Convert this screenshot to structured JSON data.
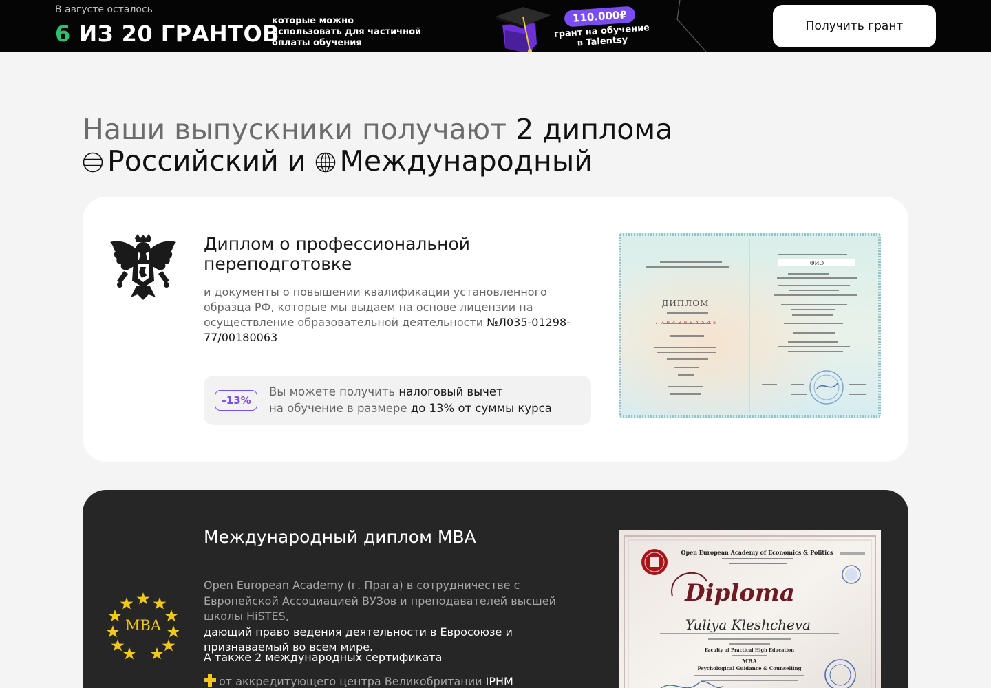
{
  "banner": {
    "remain_label": "В августе осталось",
    "count_num": "6",
    "count_text": " ИЗ 20 ГРАНТОВ",
    "desc": "которые можно использовать для частичной оплаты обучения",
    "promo_amount": "110.000₽",
    "promo_text": "грант на обучение в Talentsy",
    "cta": "Получить грант"
  },
  "headline": {
    "part1": "Наши выпускники получают ",
    "part2": "2 диплома",
    "ru": "Российский и ",
    "intl": "Международный"
  },
  "card_ru": {
    "title": "Диплом о профессиональной переподготовке",
    "desc": "и документы о повышении квалификации установленного образца РФ, которые мы выдаем на основе лицензии на осуществление образовательной деятельности ",
    "license": "№Л035-01298-77/00180063",
    "tax_badge": "–13%",
    "tax_text_1": "Вы можете получить ",
    "tax_text_2": "налоговый вычет",
    "tax_text_3": "на обучение в размере ",
    "tax_text_4": "до 13% от суммы курса",
    "diploma_word": "ДИПЛОМ",
    "diploma_fio": "ФИО"
  },
  "card_mba": {
    "logo_text": "MBA",
    "title": "Международный диплом MBA",
    "desc_muted": "Open European Academy (г. Прага) в сотрудничестве с Европейской Ассоциацией ВУЗов и преподавателей высшей школы HiSTES,",
    "desc_light": " дающий право ведения деятельности в Евросоюзе и признаваемый во всем мире.",
    "also": "А также 2 международных сертификата",
    "cert_muted": "от аккредитующего центра Великобритании ",
    "cert_light": "IPHM",
    "diploma_academy": "Open European Academy of Economics & Politics",
    "diploma_word": "Diploma",
    "diploma_name": "Yuliya Kleshcheva",
    "diploma_faculty": "Faculty of Practical High Education",
    "diploma_degree": "MBA",
    "diploma_program": "Psychological Guidance & Counselling"
  },
  "colors": {
    "accent_green": "#2fbf71",
    "accent_purple": "#7a4cf4",
    "dark_card": "#262626",
    "page_bg": "#f4f4f4"
  }
}
